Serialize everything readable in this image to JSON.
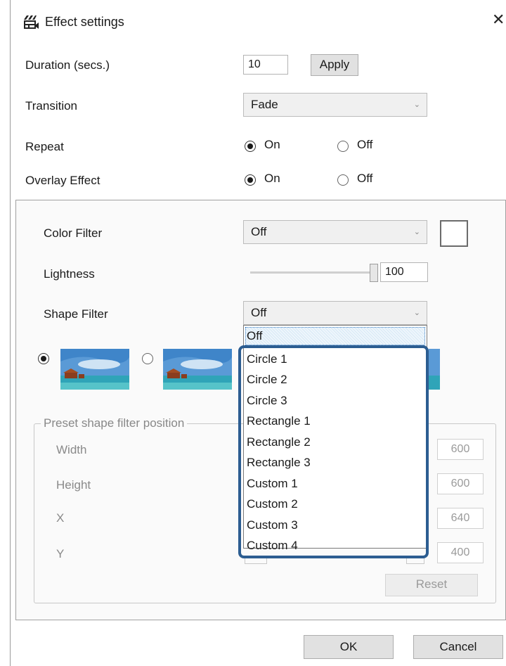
{
  "window": {
    "title": "Effect settings",
    "close_glyph": "✕",
    "icon": "clapperboard-icon"
  },
  "duration": {
    "label": "Duration (secs.)",
    "value": "10",
    "apply_label": "Apply"
  },
  "transition": {
    "label": "Transition",
    "value": "Fade"
  },
  "repeat": {
    "label": "Repeat",
    "on_label": "On",
    "off_label": "Off",
    "selected": "On"
  },
  "overlay": {
    "label": "Overlay Effect",
    "on_label": "On",
    "off_label": "Off",
    "selected": "On"
  },
  "color_filter": {
    "label": "Color Filter",
    "value": "Off",
    "swatch_color": "#ffffff"
  },
  "lightness": {
    "label": "Lightness",
    "value": "100"
  },
  "shape_filter": {
    "label": "Shape Filter",
    "value": "Off",
    "options": [
      "Off",
      "Circle 1",
      "Circle 2",
      "Circle 3",
      "Rectangle 1",
      "Rectangle 2",
      "Rectangle 3",
      "Custom 1",
      "Custom 2",
      "Custom 3",
      "Custom 4"
    ],
    "highlight_color": "#2c5d91"
  },
  "preset_position": {
    "legend": "Preset shape filter position",
    "width_label": "Width",
    "height_label": "Height",
    "x_label": "X",
    "y_label": "Y",
    "width_value": "600",
    "height_value": "600",
    "x_value": "640",
    "y_value": "400",
    "reset_label": "Reset"
  },
  "footer": {
    "ok_label": "OK",
    "cancel_label": "Cancel"
  }
}
